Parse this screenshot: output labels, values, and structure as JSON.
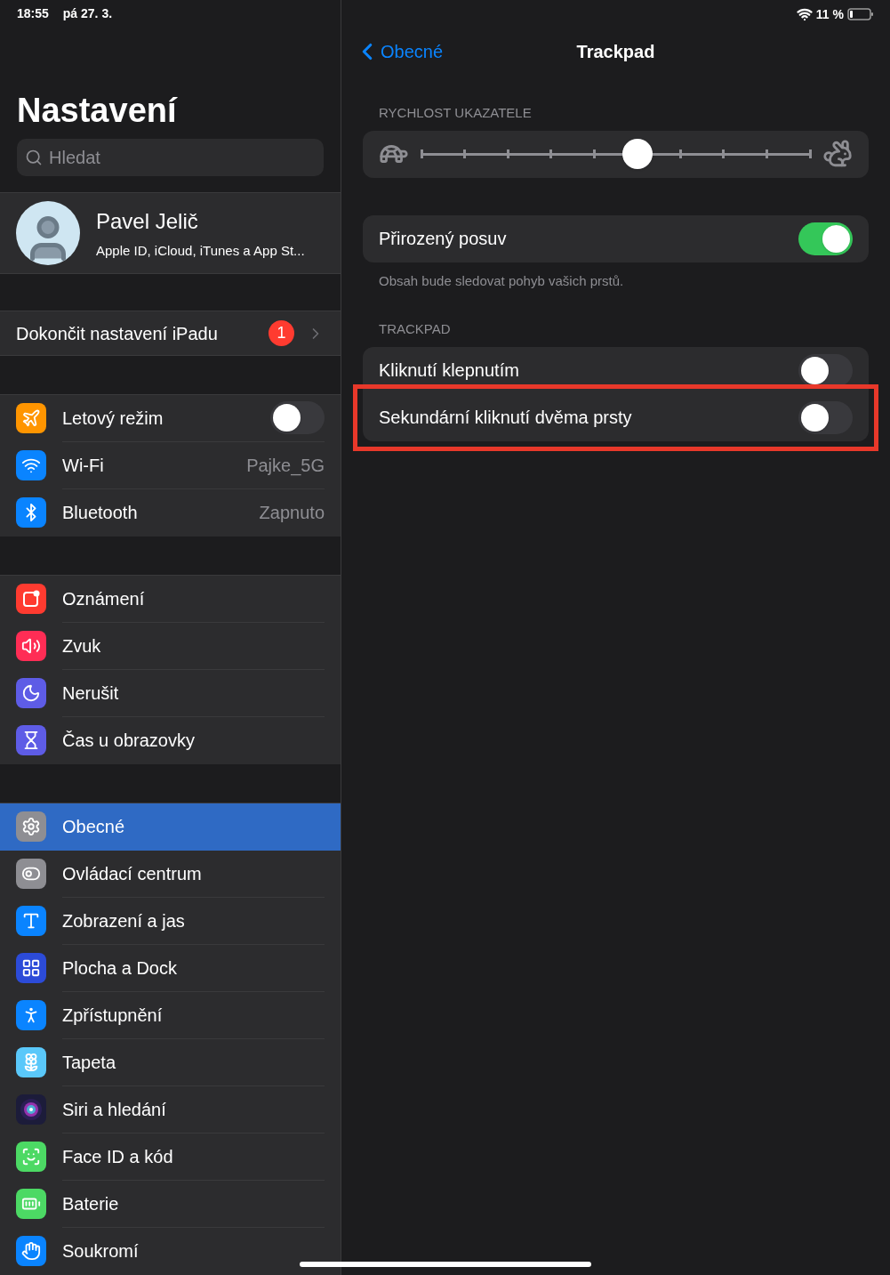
{
  "status_bar": {
    "time": "18:55",
    "date": "pá 27. 3.",
    "battery": "11 %"
  },
  "sidebar": {
    "title": "Nastavení",
    "search": {
      "placeholder": "Hledat"
    },
    "profile": {
      "name": "Pavel Jelič",
      "subtitle": "Apple ID, iCloud, iTunes a App St..."
    },
    "setup": {
      "label": "Dokončit nastavení iPadu",
      "badge": "1"
    },
    "groups": [
      {
        "items": [
          {
            "kind": "toggle",
            "label": "Letový režim",
            "on": false,
            "selected": false
          },
          {
            "kind": "value",
            "label": "Wi-Fi",
            "value": "Pajke_5G",
            "selected": false
          },
          {
            "kind": "value",
            "label": "Bluetooth",
            "value": "Zapnuto",
            "selected": false
          }
        ]
      },
      {
        "items": [
          {
            "kind": "link",
            "label": "Oznámení",
            "selected": false
          },
          {
            "kind": "link",
            "label": "Zvuk",
            "selected": false
          },
          {
            "kind": "link",
            "label": "Nerušit",
            "selected": false
          },
          {
            "kind": "link",
            "label": "Čas u obrazovky",
            "selected": false
          }
        ]
      },
      {
        "items": [
          {
            "kind": "link",
            "label": "Obecné",
            "selected": true
          },
          {
            "kind": "link",
            "label": "Ovládací centrum",
            "selected": false
          },
          {
            "kind": "link",
            "label": "Zobrazení a jas",
            "selected": false
          },
          {
            "kind": "link",
            "label": "Plocha a Dock",
            "selected": false
          },
          {
            "kind": "link",
            "label": "Zpřístupnění",
            "selected": false
          },
          {
            "kind": "link",
            "label": "Tapeta",
            "selected": false
          },
          {
            "kind": "link",
            "label": "Siri a hledání",
            "selected": false
          },
          {
            "kind": "link",
            "label": "Face ID a kód",
            "selected": false
          },
          {
            "kind": "link",
            "label": "Baterie",
            "selected": false
          },
          {
            "kind": "link",
            "label": "Soukromí",
            "selected": false
          }
        ]
      }
    ]
  },
  "detail": {
    "back": "Obecné",
    "title": "Trackpad",
    "sections": [
      {
        "kind": "slider",
        "header": "RYCHLOST UKAZATELE",
        "level": 0.556
      },
      {
        "kind": "toggles",
        "rows": [
          {
            "label": "Přirozený posuv",
            "on": true
          }
        ],
        "footer": "Obsah bude sledovat pohyb vašich prstů."
      },
      {
        "kind": "toggles",
        "header": "TRACKPAD",
        "rows": [
          {
            "label": "Kliknutí klepnutím",
            "on": false,
            "highlighted": false
          },
          {
            "label": "Sekundární kliknutí dvěma prsty",
            "on": false,
            "highlighted": true
          }
        ]
      }
    ]
  }
}
